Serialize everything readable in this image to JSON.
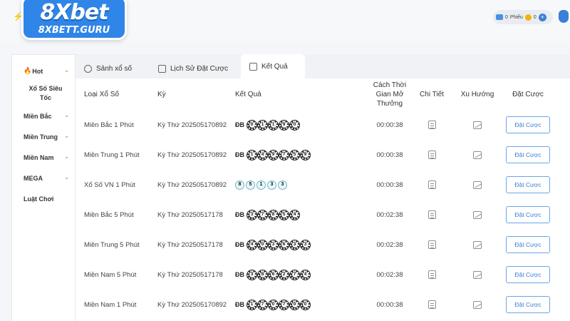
{
  "brand": {
    "logo_text": "8Xbet",
    "logo_sub": "8XBETT.GURU"
  },
  "wallet": {
    "ticket_value": "0",
    "ticket_label": "Phiếu",
    "coin_value": "0",
    "add_label": "+"
  },
  "sidebar": {
    "items": [
      {
        "label": "Hot",
        "has_chevron": true
      },
      {
        "label": "Xổ Số Siêu Tốc",
        "has_chevron": false
      },
      {
        "label": "Miền Bắc",
        "has_chevron": true
      },
      {
        "label": "Miền Trung",
        "has_chevron": true
      },
      {
        "label": "Miền Nam",
        "has_chevron": true
      },
      {
        "label": "MEGA",
        "has_chevron": true
      },
      {
        "label": "Luật Chơi",
        "has_chevron": false
      }
    ]
  },
  "tabs": [
    {
      "label": "Sảnh xổ số",
      "icon": "lottery-icon",
      "active": false
    },
    {
      "label": "Lịch Sử Đặt Cược",
      "icon": "history-icon",
      "active": false
    },
    {
      "label": "Kết Quả",
      "icon": "chart-icon",
      "active": true
    }
  ],
  "table": {
    "headers": {
      "type": "Loại Xổ Số",
      "period": "Kỳ",
      "result": "Kết Quả",
      "countdown": "Cách Thời Gian Mở Thưởng",
      "detail": "Chi Tiết",
      "trend": "Xu Hướng",
      "bet": "Đặt Cược"
    },
    "rows": [
      {
        "type": "Miền Bắc 1 Phút",
        "period": "Kỳ Thứ 202505170892",
        "prefix": "ĐB",
        "balls": [
          "0",
          "1",
          "1",
          "9",
          "0"
        ],
        "style": "dark",
        "countdown": "00:00:38",
        "bet_label": "Đặt Cược"
      },
      {
        "type": "Miền Trung 1 Phút",
        "period": "Kỳ Thứ 202505170892",
        "prefix": "ĐB",
        "balls": [
          "1",
          "4",
          "9",
          "7",
          "5",
          "9"
        ],
        "style": "dark",
        "countdown": "00:00:38",
        "bet_label": "Đặt Cược"
      },
      {
        "type": "Xổ Số VN 1 Phút",
        "period": "Kỳ Thứ 202505170892",
        "prefix": "",
        "balls": [
          "8",
          "5",
          "1",
          "3",
          "3"
        ],
        "style": "light",
        "countdown": "00:00:38",
        "bet_label": "Đặt Cược"
      },
      {
        "type": "Miền Bắc 5 Phút",
        "period": "Kỳ Thứ 20250517178",
        "prefix": "ĐB",
        "balls": [
          "3",
          "7",
          "8",
          "5",
          "4"
        ],
        "style": "dark",
        "countdown": "00:02:38",
        "bet_label": "Đặt Cược"
      },
      {
        "type": "Miền Trung 5 Phút",
        "period": "Kỳ Thứ 20250517178",
        "prefix": "ĐB",
        "balls": [
          "4",
          "0",
          "3",
          "6",
          "3",
          "3"
        ],
        "style": "dark",
        "countdown": "00:02:38",
        "bet_label": "Đặt Cược"
      },
      {
        "type": "Miền Nam 5 Phút",
        "period": "Kỳ Thứ 20250517178",
        "prefix": "ĐB",
        "balls": [
          "3",
          "8",
          "6",
          "2",
          "7",
          "4"
        ],
        "style": "dark",
        "countdown": "00:02:38",
        "bet_label": "Đặt Cược"
      },
      {
        "type": "Miền Nam 1 Phút",
        "period": "Kỳ Thứ 202505170892",
        "prefix": "ĐB",
        "balls": [
          "1",
          "7",
          "0",
          "7",
          "0",
          "0"
        ],
        "style": "dark",
        "countdown": "00:00:38",
        "bet_label": "Đặt Cược"
      }
    ]
  },
  "colors": {
    "brand_blue": "#2f86e8",
    "button_border": "#6aa6e6",
    "hot_flame": "#f26a1b"
  }
}
